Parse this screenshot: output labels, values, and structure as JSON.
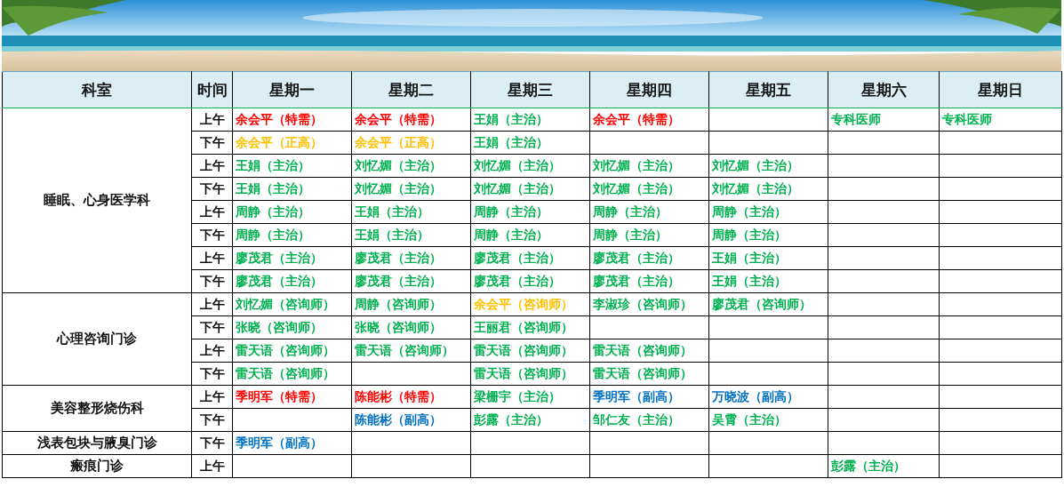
{
  "columns": [
    "科室",
    "时间",
    "星期一",
    "星期二",
    "星期三",
    "星期四",
    "星期五",
    "星期六",
    "星期日"
  ],
  "departments": [
    {
      "name": "睡眠、心身医学科",
      "slots": [
        {
          "time": "上午",
          "cells": [
            {
              "text": "余会平（特需）",
              "color": "#ff0000"
            },
            {
              "text": "余会平（特需）",
              "color": "#ff0000"
            },
            {
              "text": "王娟（主治）",
              "color": "#00b050"
            },
            {
              "text": "余会平（特需）",
              "color": "#ff0000"
            },
            null,
            {
              "text": "专科医师",
              "color": "#00b050"
            },
            {
              "text": "专科医师",
              "color": "#00b050"
            }
          ]
        },
        {
          "time": "下午",
          "cells": [
            {
              "text": "余会平（正高）",
              "color": "#ffc000"
            },
            {
              "text": "余会平（正高）",
              "color": "#ffc000"
            },
            {
              "text": "王娟（主治）",
              "color": "#00b050"
            },
            null,
            null,
            null,
            null
          ]
        },
        {
          "time": "上午",
          "cells": [
            {
              "text": "王娟（主治）",
              "color": "#00b050"
            },
            {
              "text": "刘忆媚（主治）",
              "color": "#00b050"
            },
            {
              "text": "刘忆媚（主治）",
              "color": "#00b050"
            },
            {
              "text": "刘忆媚（主治）",
              "color": "#00b050"
            },
            {
              "text": "刘忆媚（主治）",
              "color": "#00b050"
            },
            null,
            null
          ]
        },
        {
          "time": "下午",
          "cells": [
            {
              "text": "王娟（主治）",
              "color": "#00b050"
            },
            {
              "text": "刘忆媚（主治）",
              "color": "#00b050"
            },
            {
              "text": "刘忆媚（主治）",
              "color": "#00b050"
            },
            {
              "text": "刘忆媚（主治）",
              "color": "#00b050"
            },
            {
              "text": "刘忆媚（主治）",
              "color": "#00b050"
            },
            null,
            null
          ]
        },
        {
          "time": "上午",
          "cells": [
            {
              "text": "周静（主治）",
              "color": "#00b050"
            },
            {
              "text": "王娟（主治）",
              "color": "#00b050"
            },
            {
              "text": "周静（主治）",
              "color": "#00b050"
            },
            {
              "text": "周静（主治）",
              "color": "#00b050"
            },
            {
              "text": "周静（主治）",
              "color": "#00b050"
            },
            null,
            null
          ]
        },
        {
          "time": "下午",
          "cells": [
            {
              "text": "周静（主治）",
              "color": "#00b050"
            },
            {
              "text": "王娟（主治）",
              "color": "#00b050"
            },
            {
              "text": "周静（主治）",
              "color": "#00b050"
            },
            {
              "text": "周静（主治）",
              "color": "#00b050"
            },
            {
              "text": "周静（主治）",
              "color": "#00b050"
            },
            null,
            null
          ]
        },
        {
          "time": "上午",
          "cells": [
            {
              "text": "廖茂君（主治）",
              "color": "#00b050"
            },
            {
              "text": "廖茂君（主治）",
              "color": "#00b050"
            },
            {
              "text": "廖茂君（主治）",
              "color": "#00b050"
            },
            {
              "text": "廖茂君（主治）",
              "color": "#00b050"
            },
            {
              "text": "王娟（主治）",
              "color": "#00b050"
            },
            null,
            null
          ]
        },
        {
          "time": "下午",
          "cells": [
            {
              "text": "廖茂君（主治）",
              "color": "#00b050"
            },
            {
              "text": "廖茂君（主治）",
              "color": "#00b050"
            },
            {
              "text": "廖茂君（主治）",
              "color": "#00b050"
            },
            {
              "text": "廖茂君（主治）",
              "color": "#00b050"
            },
            {
              "text": "王娟（主治）",
              "color": "#00b050"
            },
            null,
            null
          ]
        }
      ]
    },
    {
      "name": "心理咨询门诊",
      "slots": [
        {
          "time": "上午",
          "cells": [
            {
              "text": "刘忆媚（咨询师）",
              "color": "#00b050"
            },
            {
              "text": "周静（咨询师）",
              "color": "#00b050"
            },
            {
              "text": "余会平（咨询师）",
              "color": "#ffc000"
            },
            {
              "text": "李淑珍（咨询师）",
              "color": "#00b050"
            },
            {
              "text": "廖茂君（咨询师）",
              "color": "#00b050"
            },
            null,
            null
          ]
        },
        {
          "time": "下午",
          "cells": [
            {
              "text": "张晓（咨询师）",
              "color": "#00b050"
            },
            {
              "text": "张晓（咨询师）",
              "color": "#00b050"
            },
            {
              "text": "王丽君（咨询师）",
              "color": "#00b050"
            },
            null,
            null,
            null,
            null
          ]
        },
        {
          "time": "上午",
          "cells": [
            {
              "text": "雷天语（咨询师）",
              "color": "#00b050"
            },
            {
              "text": "雷天语（咨询师）",
              "color": "#00b050"
            },
            {
              "text": "雷天语（咨询师）",
              "color": "#00b050"
            },
            {
              "text": "雷天语（咨询师）",
              "color": "#00b050"
            },
            null,
            null,
            null
          ]
        },
        {
          "time": "下午",
          "cells": [
            {
              "text": "雷天语（咨询师）",
              "color": "#00b050"
            },
            null,
            {
              "text": "雷天语（咨询师）",
              "color": "#00b050"
            },
            {
              "text": "雷天语（咨询师）",
              "color": "#00b050"
            },
            null,
            null,
            null
          ]
        }
      ]
    },
    {
      "name": "美容整形烧伤科",
      "slots": [
        {
          "time": "上午",
          "cells": [
            {
              "text": "季明军（特需）",
              "color": "#ff0000"
            },
            {
              "text": "陈能彬（特需）",
              "color": "#ff0000"
            },
            {
              "text": "梁栅宇（主治）",
              "color": "#00b050"
            },
            {
              "text": "季明军（副高）",
              "color": "#0070c0"
            },
            {
              "text": "万晓波（副高）",
              "color": "#0070c0"
            },
            null,
            null
          ]
        },
        {
          "time": "下午",
          "cells": [
            null,
            {
              "text": "陈能彬（副高）",
              "color": "#0070c0"
            },
            {
              "text": "彭露（主治）",
              "color": "#00b050"
            },
            {
              "text": "邹仁友（主治）",
              "color": "#00b050"
            },
            {
              "text": "吴霄（主治）",
              "color": "#00b050"
            },
            null,
            null
          ]
        }
      ]
    },
    {
      "name": "浅表包块与腋臭门诊",
      "slots": [
        {
          "time": "下午",
          "cells": [
            {
              "text": "季明军（副高）",
              "color": "#0070c0"
            },
            null,
            null,
            null,
            null,
            null,
            null
          ]
        }
      ]
    },
    {
      "name": "瘢痕门诊",
      "slots": [
        {
          "time": "上午",
          "cells": [
            null,
            null,
            null,
            null,
            null,
            {
              "text": "彭露（主治）",
              "color": "#00b050"
            },
            null
          ]
        }
      ]
    }
  ]
}
